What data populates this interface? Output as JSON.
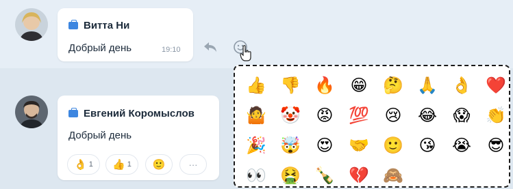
{
  "messages": [
    {
      "sender": "Витта Ни",
      "text": "Добрый день",
      "time": "19:10"
    },
    {
      "sender": "Евгений Коромыслов",
      "text": "Добрый день",
      "reactions": [
        {
          "emoji": "👌",
          "count": "1"
        },
        {
          "emoji": "👍",
          "count": "1"
        },
        {
          "emoji": "🙂",
          "count": ""
        },
        {
          "emoji": "···",
          "count": ""
        }
      ]
    }
  ],
  "icons": {
    "reply": "reply-icon",
    "react": "add-reaction-icon",
    "cursor": "hand-cursor-icon",
    "briefcase": "briefcase-icon"
  },
  "emoji_picker": {
    "emojis": [
      "👍",
      "👎",
      "🔥",
      "😁",
      "🤔",
      "🙏",
      "👌",
      "❤️",
      "🤷",
      "🤡",
      "😡",
      "💯",
      "😢",
      "😂",
      "😱",
      "👏",
      "🎉",
      "🤯",
      "😍",
      "🤝",
      "🙂",
      "😘",
      "😭",
      "😎",
      "👀",
      "🤮",
      "🍾",
      "💔",
      "🙈"
    ]
  },
  "colors": {
    "accent": "#3d86e0",
    "picker_border": "#1a1a1a",
    "background": "#dfe8f0"
  }
}
